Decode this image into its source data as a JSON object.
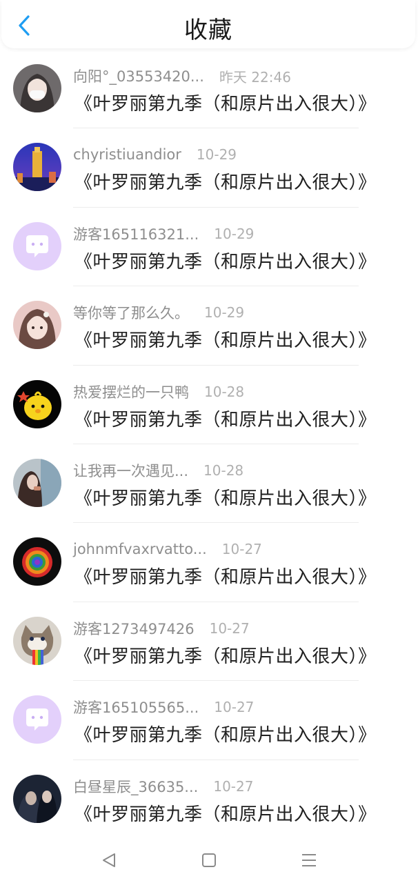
{
  "header": {
    "title": "收藏"
  },
  "items": [
    {
      "name": "向阳°_03553420...",
      "time": "昨天 22:46",
      "title": "《叶罗丽第九季（和原片出入很大）》",
      "avatar": "girl-mask-avatar"
    },
    {
      "name": "chyristiuandior",
      "time": "10-29",
      "title": "《叶罗丽第九季（和原片出入很大）》",
      "avatar": "city-night-avatar"
    },
    {
      "name": "游客165116321...",
      "time": "10-29",
      "title": "《叶罗丽第九季（和原片出入很大）》",
      "avatar": "default-chat-avatar"
    },
    {
      "name": "等你等了那么久。",
      "time": "10-29",
      "title": "《叶罗丽第九季（和原片出入很大）》",
      "avatar": "anime-girl-avatar"
    },
    {
      "name": "热爱摆烂的一只鸭",
      "time": "10-28",
      "title": "《叶罗丽第九季（和原片出入很大）》",
      "avatar": "yellow-duck-avatar"
    },
    {
      "name": "让我再一次遇见...",
      "time": "10-28",
      "title": "《叶罗丽第九季（和原片出入很大）》",
      "avatar": "girl-window-avatar"
    },
    {
      "name": "johnmfvaxrvatto...",
      "time": "10-27",
      "title": "《叶罗丽第九季（和原片出入很大）》",
      "avatar": "rainbow-rose-avatar"
    },
    {
      "name": "游客1273497426",
      "time": "10-27",
      "title": "《叶罗丽第九季（和原片出入很大）》",
      "avatar": "grumpy-cat-avatar"
    },
    {
      "name": "游客165105565...",
      "time": "10-27",
      "title": "《叶罗丽第九季（和原片出入很大）》",
      "avatar": "default-chat-avatar"
    },
    {
      "name": "白昼星辰_36635...",
      "time": "10-27",
      "title": "《叶罗丽第九季（和原片出入很大）》",
      "avatar": "couple-dark-avatar"
    }
  ],
  "colors": {
    "accent": "#1e9df2",
    "name": "#8e8e8e",
    "time": "#b0b0b0",
    "title": "#1f1f1f",
    "default_avatar": "#e3d0fb"
  }
}
